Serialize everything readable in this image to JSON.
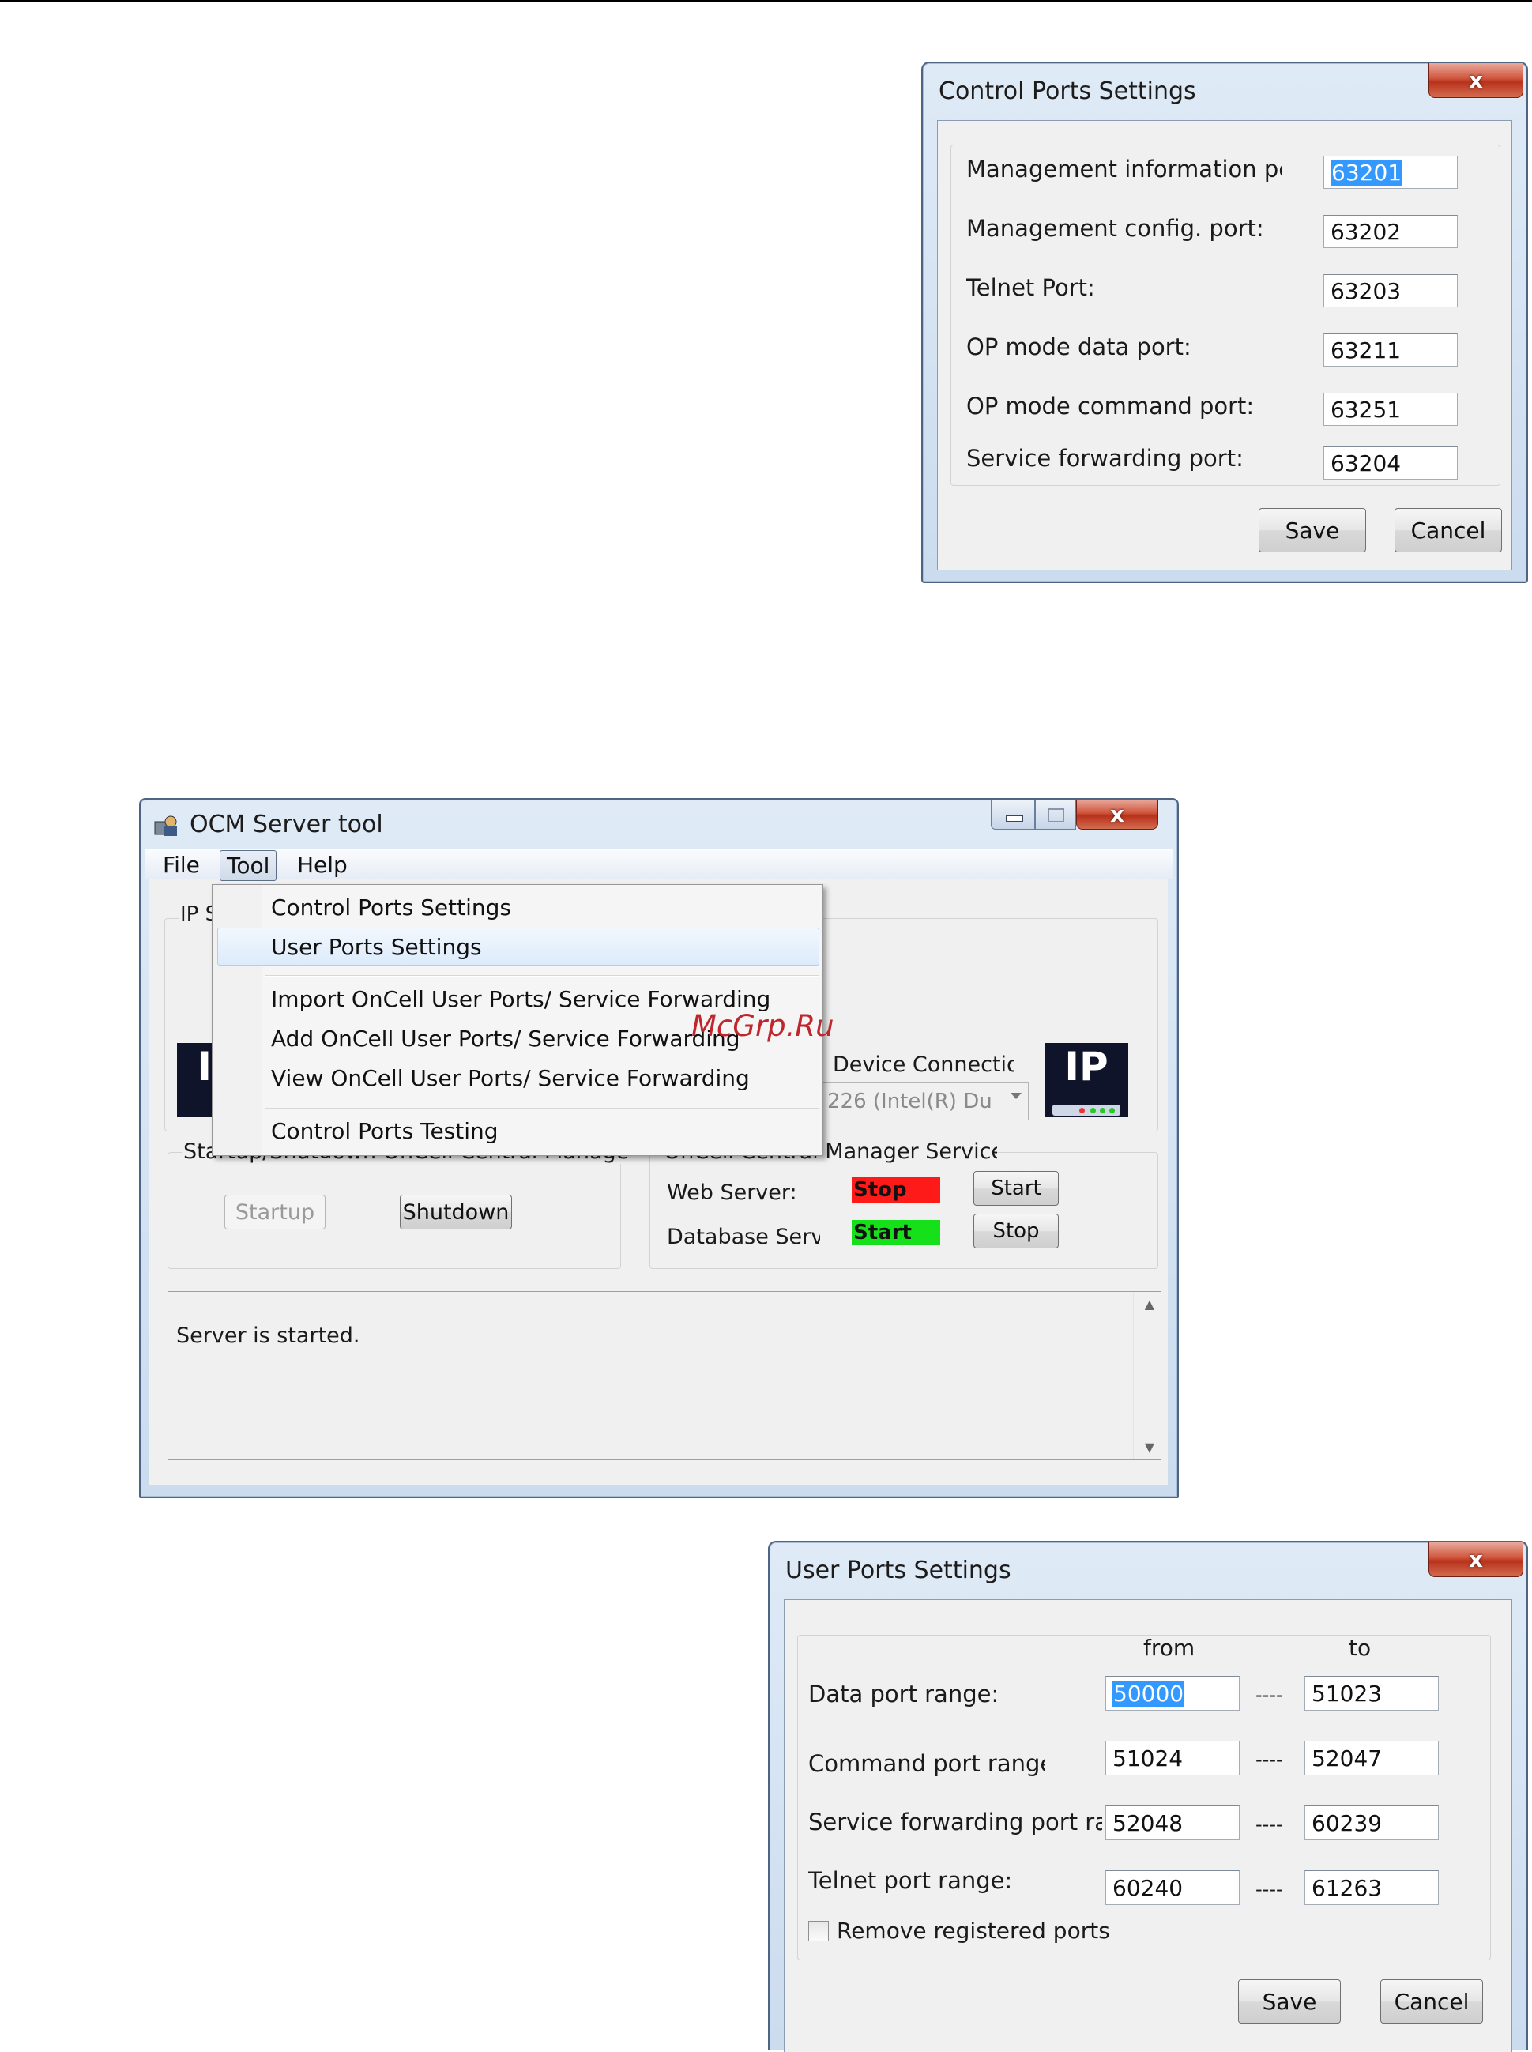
{
  "control_ports_dialog": {
    "title": "Control Ports Settings",
    "close_glyph": "x",
    "rows": [
      {
        "label": "Management information pc",
        "value": "63201",
        "selected": true
      },
      {
        "label": "Management config. port:",
        "value": "63202"
      },
      {
        "label": "Telnet Port:",
        "value": "63203"
      },
      {
        "label": "OP mode data port:",
        "value": "63211"
      },
      {
        "label": "OP mode command port:",
        "value": "63251"
      },
      {
        "label": "Service forwarding port:",
        "value": "63204"
      }
    ],
    "save_label": "Save",
    "cancel_label": "Cancel"
  },
  "ocm_window": {
    "title": "OCM Server tool",
    "menu": {
      "file": "File",
      "tool": "Tool",
      "help": "Help"
    },
    "tool_menu_items": [
      "Control Ports Settings",
      "User Ports Settings",
      "Import OnCell User Ports/ Service Forwarding",
      "Add OnCell User Ports/ Service Forwarding",
      "View OnCell User Ports/ Service Forwarding",
      "Control Ports Testing"
    ],
    "ip_group_partial_label": "IP S",
    "device_connection_label": "Device Connectio",
    "device_combo_value": "226 (Intel(R) Du",
    "ip_icon_text": "IP",
    "startup_group_label": "Startup/Shutdown OnCell Central Manager",
    "startup_button": "Startup",
    "shutdown_button": "Shutdown",
    "service_group_label": "OnCell Central Manager Service",
    "web_server_label": "Web Server:",
    "web_server_status": "Stop",
    "web_server_status_color": "#ff1a1a",
    "web_server_action": "Start",
    "database_label": "Database Serve",
    "database_status": "Start",
    "database_status_color": "#16e01a",
    "database_action": "Stop",
    "log_text": "Server is started."
  },
  "watermark": "McGrp.Ru",
  "user_ports_dialog": {
    "title": "User Ports Settings",
    "close_glyph": "x",
    "from_header": "from",
    "to_header": "to",
    "separator": "----",
    "rows": [
      {
        "label": "Data port range:",
        "from": "50000",
        "to": "51023",
        "selected": true
      },
      {
        "label": "Command port range",
        "from": "51024",
        "to": "52047"
      },
      {
        "label": "Service forwarding port ran",
        "from": "52048",
        "to": "60239"
      },
      {
        "label": "Telnet port range:",
        "from": "60240",
        "to": "61263"
      }
    ],
    "checkbox_label": "Remove registered ports",
    "save_label": "Save",
    "cancel_label": "Cancel"
  }
}
